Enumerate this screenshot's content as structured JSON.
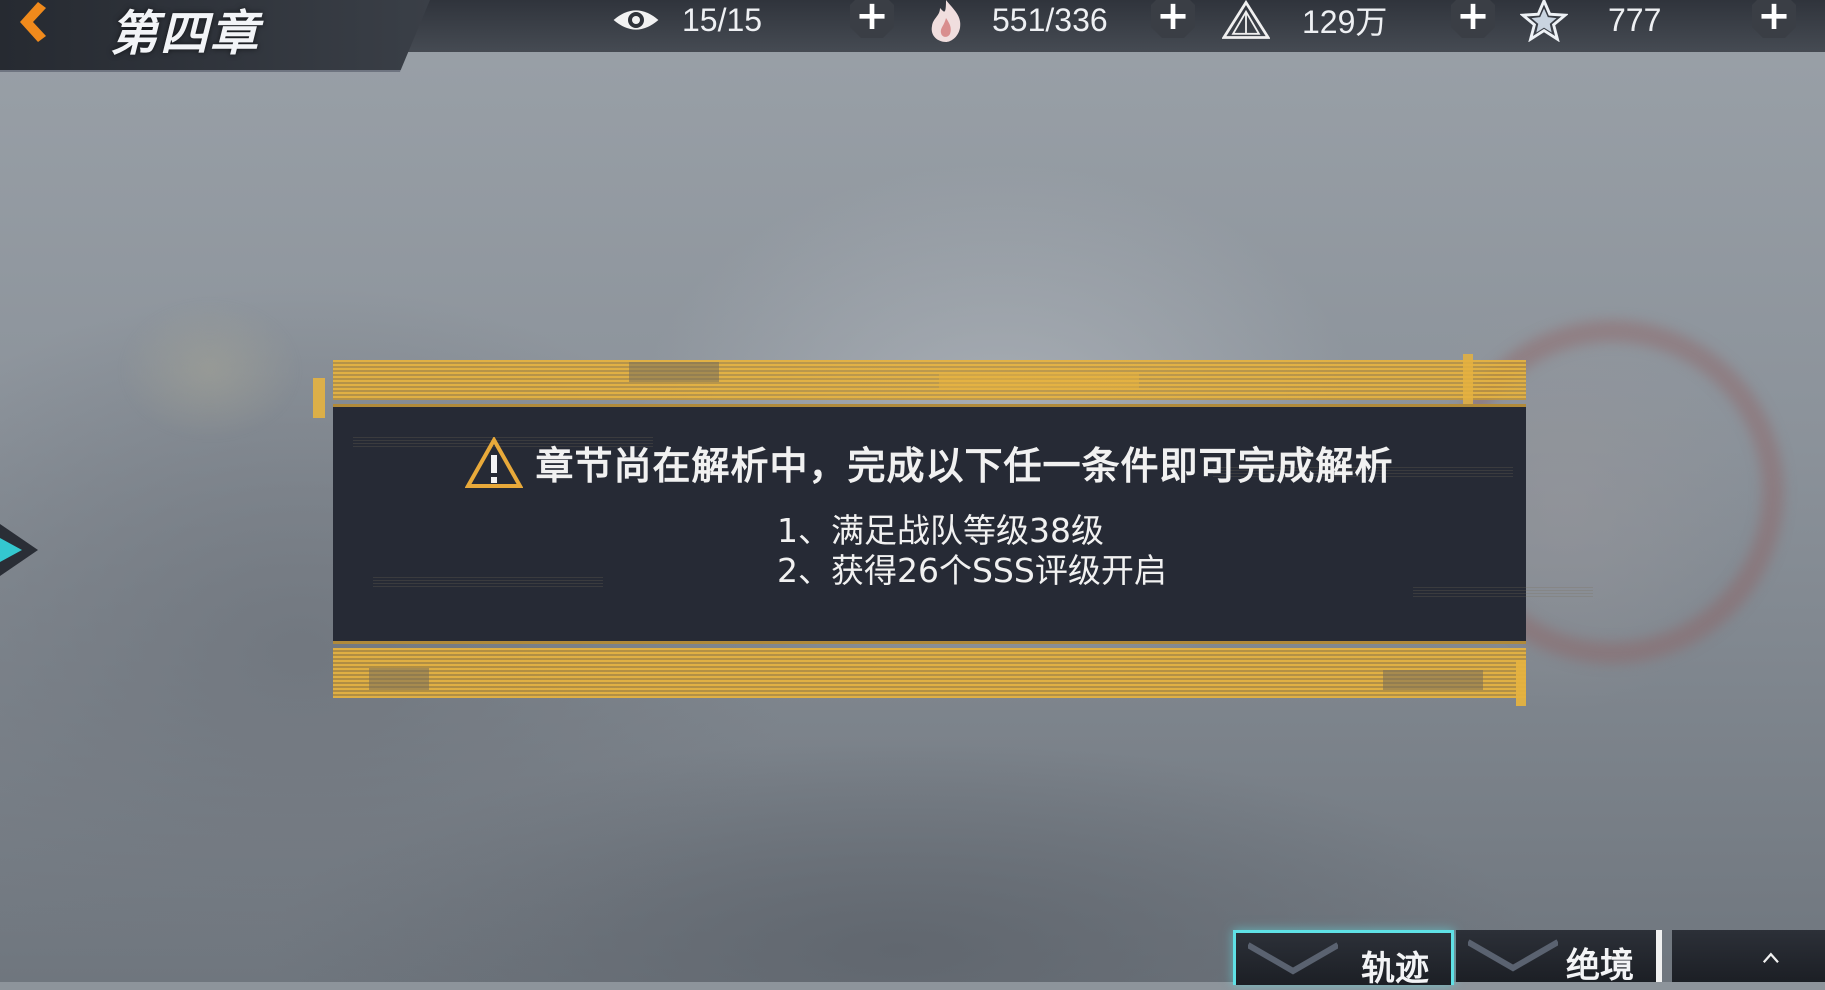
{
  "header": {
    "chapter_title": "第四章",
    "back_icon": "back-arrow-icon",
    "resources": [
      {
        "name": "stamina",
        "icon": "eye-icon",
        "value": "15/15"
      },
      {
        "name": "energy",
        "icon": "flame-icon",
        "value": "551/336"
      },
      {
        "name": "currency",
        "icon": "triangle-emblem-icon",
        "value": "129万"
      },
      {
        "name": "star-crystal",
        "icon": "star-icon",
        "value": "777"
      }
    ],
    "plus_label": "+"
  },
  "dialog": {
    "warning_text": "章节尚在解析中，完成以下任一条件即可完成解析",
    "conditions": [
      "1、满足战队等级38级",
      "2、获得26个SSS评级开启"
    ]
  },
  "bottom_tabs": [
    {
      "label": "轨迹",
      "selected": true
    },
    {
      "label": "绝境",
      "selected": false
    },
    {
      "label": "",
      "selected": false
    }
  ],
  "colors": {
    "accent_gold": "#e5b240",
    "accent_cyan": "#5fe1e6",
    "back_orange": "#f08a1c",
    "dialog_bg": "#262a35"
  }
}
